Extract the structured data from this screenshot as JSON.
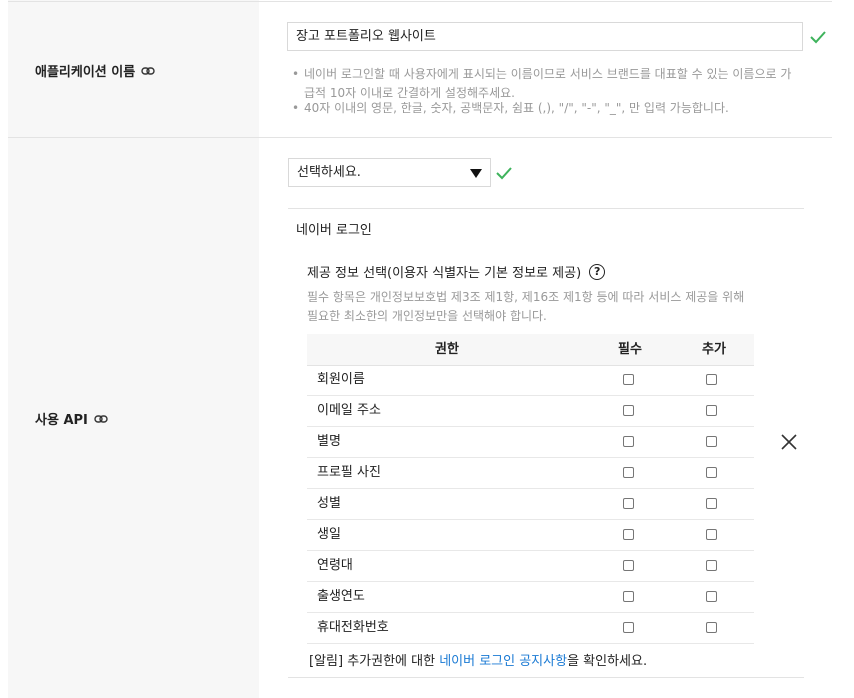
{
  "app_name_row": {
    "label": "애플리케이션 이름",
    "input_value": "장고 포트폴리오 웹사이트",
    "hints": [
      "네이버 로그인할 때 사용자에게 표시되는 이름이므로 서비스 브랜드를 대표할 수 있는 이름으로 가급적 10자 이내로 간결하게 설정해주세요.",
      "40자 이내의 영문, 한글, 숫자, 공백문자, 쉼표 (,), \"/\", \"-\", \"_\", 만 입력 가능합니다."
    ]
  },
  "api_row": {
    "label": "사용 API",
    "select_value": "선택하세요.",
    "section_title": "네이버 로그인",
    "provide_title": "제공 정보 선택(이용자 식별자는 기본 정보로 제공)",
    "provide_desc": "필수 항목은 개인정보보호법 제3조 제1항, 제16조 제1항 등에 따라 서비스 제공을 위해 필요한 최소한의 개인정보만을 선택해야 합니다.",
    "table": {
      "headers": [
        "권한",
        "필수",
        "추가"
      ],
      "rows": [
        {
          "name": "회원이름",
          "required": false,
          "extra": false
        },
        {
          "name": "이메일 주소",
          "required": false,
          "extra": false
        },
        {
          "name": "별명",
          "required": false,
          "extra": false
        },
        {
          "name": "프로필 사진",
          "required": false,
          "extra": false
        },
        {
          "name": "성별",
          "required": false,
          "extra": false
        },
        {
          "name": "생일",
          "required": false,
          "extra": false
        },
        {
          "name": "연령대",
          "required": false,
          "extra": false
        },
        {
          "name": "출생연도",
          "required": false,
          "extra": false
        },
        {
          "name": "휴대전화번호",
          "required": false,
          "extra": false
        }
      ]
    },
    "notice_prefix": "[알림] 추가권한에 대한 ",
    "notice_link": "네이버 로그인 공지사항",
    "notice_suffix": "을 확인하세요."
  },
  "colors": {
    "check": "#3eb35c",
    "link": "#1a7ad4",
    "label_bg": "#f7f7f7"
  }
}
